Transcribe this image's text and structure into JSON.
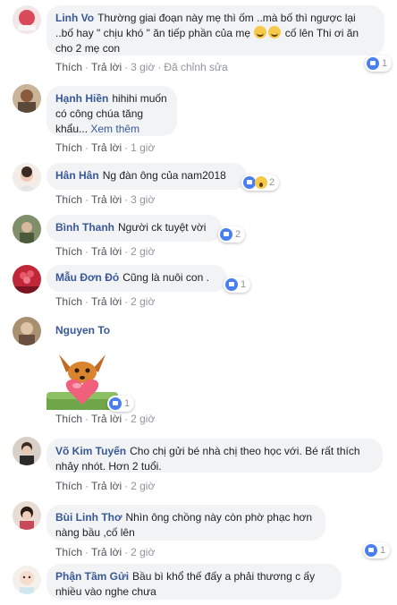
{
  "comments": [
    {
      "name": "Linh Vo",
      "text_a": "Thường giai đoạn này mẹ thì ốm ..mà bố thì ngược lại ..bố hay \" chịu khó \" ăn tiếp phần của mẹ",
      "text_b": "cố lên Thi ơi ăn cho 2 mẹ con",
      "emoji": "laughing-emoji",
      "like": "Thích",
      "reply": "Trả lời",
      "time": "3 giờ",
      "edited": "Đã chỉnh sửa",
      "reaction_icon": "like-icon",
      "reaction_count": "1"
    },
    {
      "name": "Hạnh Hiền",
      "text": "hihihi muốn có công chúa tăng khẩu...",
      "see_more": "Xem thêm",
      "like": "Thích",
      "reply": "Trả lời",
      "time": "1 giờ"
    },
    {
      "name": "Hân Hân",
      "text": "Ng đàn ông của nam2018",
      "like": "Thích",
      "reply": "Trả lời",
      "time": "3 giờ",
      "reaction_icon": "like-and-wow-icons",
      "reaction_count": "2"
    },
    {
      "name": "Bình Thanh",
      "text": "Người ck tuyệt vời",
      "like": "Thích",
      "reply": "Trả lời",
      "time": "2 giờ",
      "reaction_icon": "like-icon",
      "reaction_count": "2"
    },
    {
      "name": "Mẫu Đơn Đỏ",
      "text": "Cũng là nuôi con .",
      "like": "Thích",
      "reply": "Trả lời",
      "time": "2 giờ",
      "reaction_icon": "like-icon",
      "reaction_count": "1"
    },
    {
      "name": "Nguyen To",
      "sticker": "fox-holding-heart-sticker",
      "like": "Thích",
      "reply": "Trả lời",
      "time": "2 giờ",
      "reaction_icon": "like-icon",
      "reaction_count": "1"
    },
    {
      "name": "Võ Kim Tuyến",
      "text": "Cho chị gửi bé nhà chị theo học với. Bé rất thích nhảy nhót. Hơn 2 tuổi.",
      "like": "Thích",
      "reply": "Trả lời",
      "time": "2 giờ"
    },
    {
      "name": "Bùi Linh Thơ",
      "text": "Nhìn ông chồng này còn phờ phạc hơn nàng bầu ,cố lên",
      "like": "Thích",
      "reply": "Trả lời",
      "time": "2 giờ",
      "reaction_icon": "like-icon",
      "reaction_count": "1"
    },
    {
      "name": "Phận Tầm Gửi",
      "text": "Bầu bì khổ thế đấy a phải thương c ấy nhiều vào nghe chưa"
    }
  ],
  "colors": {
    "name": "#385898",
    "bubble": "#f2f3f5",
    "meta": "#90949c",
    "like_blue": "#4a7ff0"
  }
}
